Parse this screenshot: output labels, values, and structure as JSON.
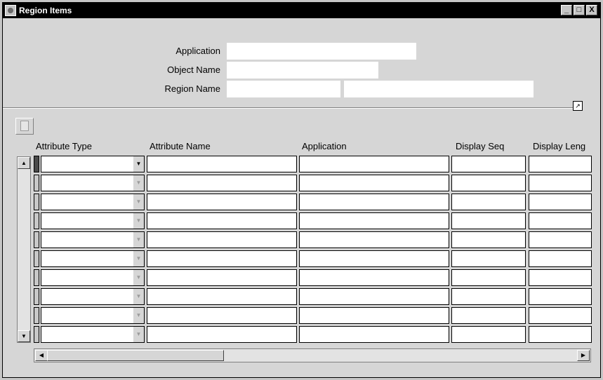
{
  "window": {
    "title": "Region Items",
    "minimize": "_",
    "maximize": "□",
    "close": "X"
  },
  "header_fields": {
    "application_label": "Application",
    "object_name_label": "Object Name",
    "region_name_label": "Region Name",
    "application_value": "",
    "object_name_value": "",
    "region_app_value": "",
    "region_name_value": ""
  },
  "table": {
    "columns": [
      "Attribute Type",
      "Attribute Name",
      "Application",
      "Display Seq",
      "Display Leng"
    ],
    "rows": [
      [
        "",
        "",
        "",
        "",
        ""
      ],
      [
        "",
        "",
        "",
        "",
        ""
      ],
      [
        "",
        "",
        "",
        "",
        ""
      ],
      [
        "",
        "",
        "",
        "",
        ""
      ],
      [
        "",
        "",
        "",
        "",
        ""
      ],
      [
        "",
        "",
        "",
        "",
        ""
      ],
      [
        "",
        "",
        "",
        "",
        ""
      ],
      [
        "",
        "",
        "",
        "",
        ""
      ],
      [
        "",
        "",
        "",
        "",
        ""
      ],
      [
        "",
        "",
        "",
        "",
        ""
      ]
    ]
  },
  "icons": {
    "system_menu": "window-menu-icon",
    "toolbar": "new-record-icon",
    "corner": "expand-icon",
    "scroll_up": "▲",
    "scroll_down": "▼",
    "scroll_left": "◀",
    "scroll_right": "▶",
    "dropdown": "▼"
  }
}
